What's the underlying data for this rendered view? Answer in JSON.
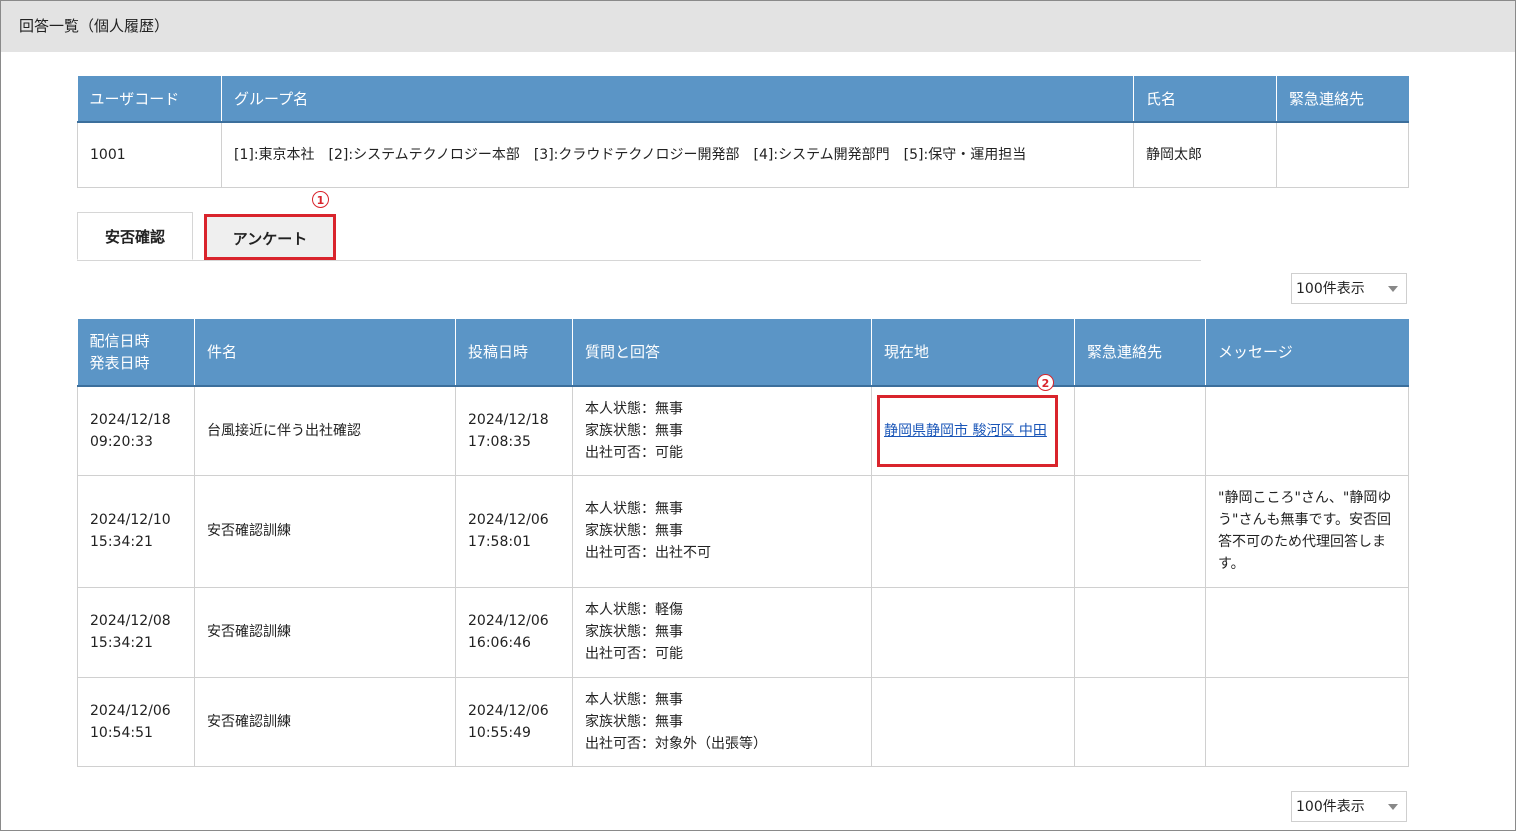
{
  "page": {
    "title": "回答一覧（個人履歴）"
  },
  "user_table": {
    "headers": [
      "ユーザコード",
      "グループ名",
      "氏名",
      "緊急連絡先"
    ],
    "row": {
      "user_code": "1001",
      "group": "[1]:東京本社　[2]:システムテクノロジー本部　[3]:クラウドテクノロジー開発部　[4]:システム開発部門　[5]:保守・運用担当",
      "name": "静岡太郎",
      "emergency": ""
    }
  },
  "tabs": {
    "safety": "安否確認",
    "survey": "アンケート"
  },
  "markers": {
    "one": "1",
    "two": "2"
  },
  "per_page": {
    "label": "100件表示"
  },
  "history": {
    "headers": {
      "sent_line1": "配信日時",
      "sent_line2": "発表日時",
      "subject": "件名",
      "posted": "投稿日時",
      "qa": "質問と回答",
      "location": "現在地",
      "emergency": "緊急連絡先",
      "message": "メッセージ"
    },
    "rows": [
      {
        "sent_date": "2024/12/18",
        "sent_time": "09:20:33",
        "subject": "台風接近に伴う出社確認",
        "posted_date": "2024/12/18",
        "posted_time": "17:08:35",
        "qa1": "本人状態：無事",
        "qa2": "家族状態：無事",
        "qa3": "出社可否：可能",
        "location": "静岡県静岡市 駿河区 中田",
        "emergency": "",
        "message": ""
      },
      {
        "sent_date": "2024/12/10",
        "sent_time": "15:34:21",
        "subject": "安否確認訓練",
        "posted_date": "2024/12/06",
        "posted_time": "17:58:01",
        "qa1": "本人状態：無事",
        "qa2": "家族状態：無事",
        "qa3": "出社可否：出社不可",
        "location": "",
        "emergency": "",
        "message": "\"静岡こころ\"さん、\"静岡ゆう\"さんも無事です。安否回答不可のため代理回答します。"
      },
      {
        "sent_date": "2024/12/08",
        "sent_time": "15:34:21",
        "subject": "安否確認訓練",
        "posted_date": "2024/12/06",
        "posted_time": "16:06:46",
        "qa1": "本人状態：軽傷",
        "qa2": "家族状態：無事",
        "qa3": "出社可否：可能",
        "location": "",
        "emergency": "",
        "message": ""
      },
      {
        "sent_date": "2024/12/06",
        "sent_time": "10:54:51",
        "subject": "安否確認訓練",
        "posted_date": "2024/12/06",
        "posted_time": "10:55:49",
        "qa1": "本人状態：無事",
        "qa2": "家族状態：無事",
        "qa3": "出社可否：対象外（出張等）",
        "location": "",
        "emergency": "",
        "message": ""
      }
    ]
  },
  "colors": {
    "header_bg": "#5b95c6",
    "highlight": "#d9242c",
    "link": "#1a56b8"
  }
}
